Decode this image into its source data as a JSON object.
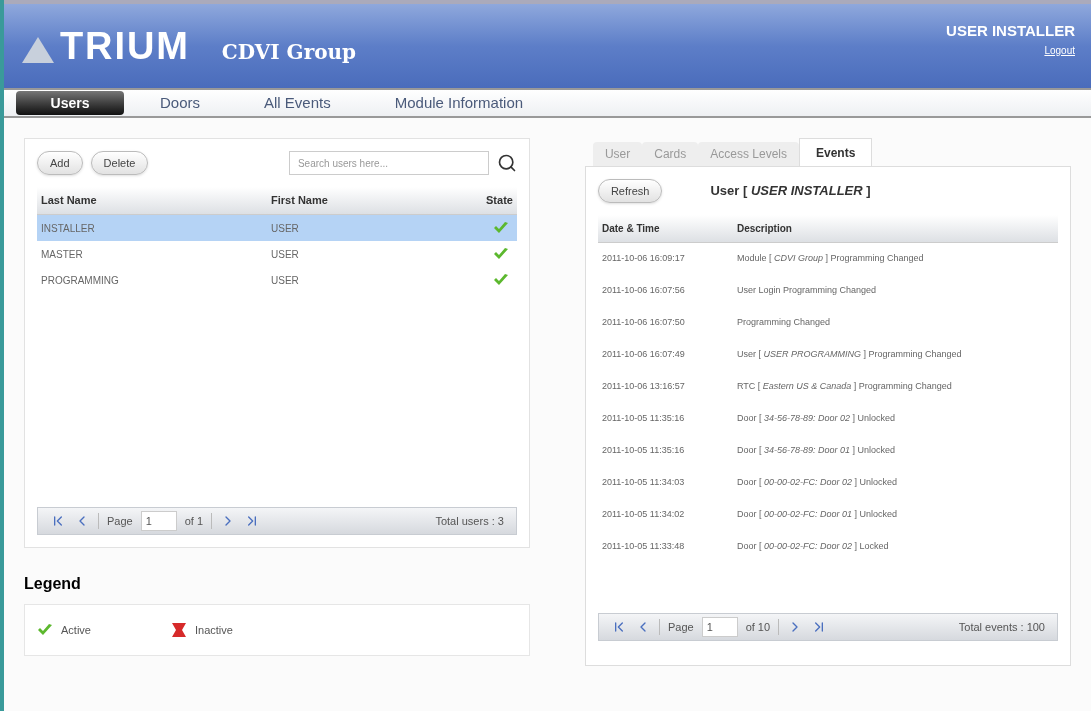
{
  "header": {
    "logo": "TRIUM",
    "company": "CDVI Group",
    "user": "USER INSTALLER",
    "logout": "Logout"
  },
  "nav": [
    {
      "label": "Users",
      "selected": true
    },
    {
      "label": "Doors",
      "selected": false
    },
    {
      "label": "All Events",
      "selected": false
    },
    {
      "label": "Module Information",
      "selected": false
    }
  ],
  "users_panel": {
    "buttons": [
      "Add",
      "Delete"
    ],
    "search": {
      "placeholder": "Search users here..."
    },
    "columns": [
      "Last Name",
      "First Name",
      "State"
    ],
    "rows": [
      {
        "last_name": "INSTALLER",
        "first_name": "USER",
        "kind": "active",
        "selected": true
      },
      {
        "last_name": "MASTER",
        "first_name": "USER",
        "kind": "active",
        "selected": false
      },
      {
        "last_name": "PROGRAMMING",
        "first_name": "USER",
        "kind": "active",
        "selected": false
      }
    ],
    "pager": {
      "page_label": "Page",
      "page": "1",
      "of": "of 1",
      "total": "Total users : 3"
    }
  },
  "legend": {
    "title": "Legend",
    "items": [
      {
        "kind": "active",
        "label": "Active"
      },
      {
        "kind": "inactive",
        "label": "Inactive"
      }
    ]
  },
  "detail_panel": {
    "tabs": [
      {
        "label": "User",
        "selected": false
      },
      {
        "label": "Cards",
        "selected": false
      },
      {
        "label": "Access Levels",
        "selected": false
      },
      {
        "label": "Events",
        "selected": true
      }
    ],
    "refresh": "Refresh",
    "heading": "User [ *USER INSTALLER* ]",
    "columns": [
      "Date & Time",
      "Description"
    ],
    "rows": [
      {
        "time": "2011-10-06 16:09:17",
        "description": "Module [ *CDVI Group* ] Programming Changed"
      },
      {
        "time": "2011-10-06 16:07:56",
        "description": "User Login Programming Changed"
      },
      {
        "time": "2011-10-06 16:07:50",
        "description": "Programming Changed"
      },
      {
        "time": "2011-10-06 16:07:49",
        "description": "User [ *USER PROGRAMMING* ] Programming Changed"
      },
      {
        "time": "2011-10-06 13:16:57",
        "description": "RTC [ *Eastern US & Canada* ] Programming Changed"
      },
      {
        "time": "2011-10-05 11:35:16",
        "description": "Door [ *34-56-78-89: Door 02* ] Unlocked"
      },
      {
        "time": "2011-10-05 11:35:16",
        "description": "Door [ *34-56-78-89: Door 01* ] Unlocked"
      },
      {
        "time": "2011-10-05 11:34:03",
        "description": "Door [ *00-00-02-FC: Door 02* ] Unlocked"
      },
      {
        "time": "2011-10-05 11:34:02",
        "description": "Door [ *00-00-02-FC: Door 01* ] Unlocked"
      },
      {
        "time": "2011-10-05 11:33:48",
        "description": "Door [ *00-00-02-FC: Door 02* ] Locked"
      }
    ],
    "pager": {
      "page_label": "Page",
      "page": "1",
      "of": "of 10",
      "total": "Total events : 100"
    }
  }
}
